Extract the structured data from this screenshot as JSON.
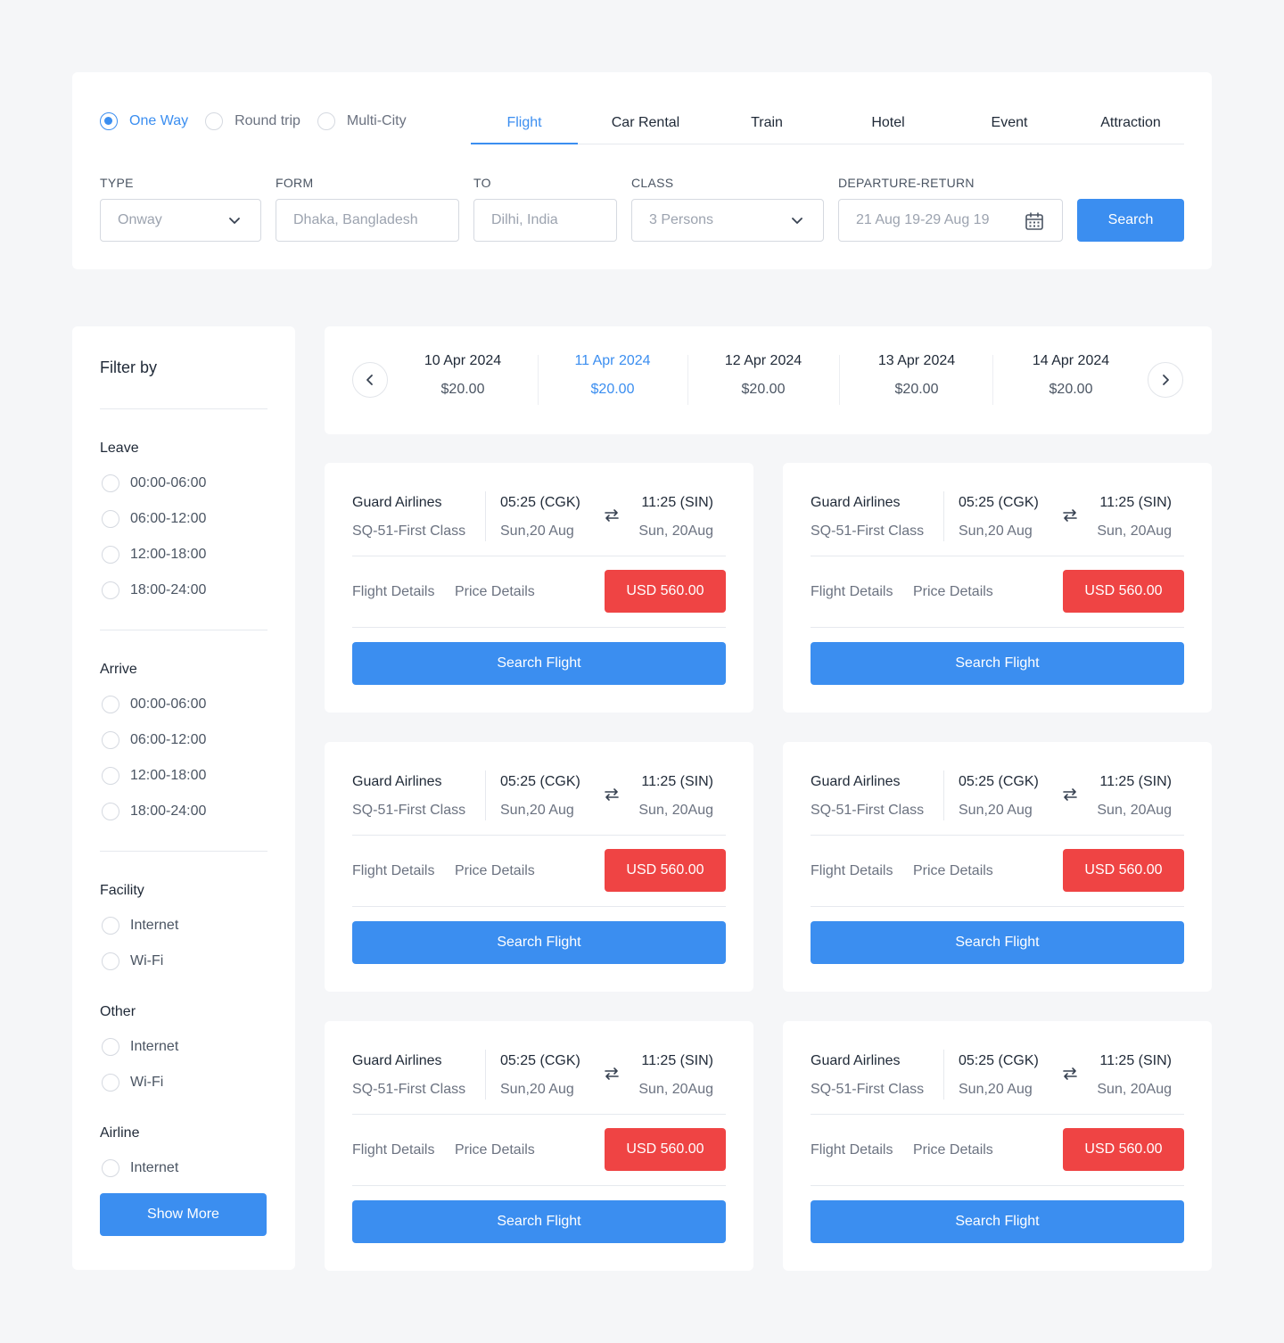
{
  "trip_types": [
    {
      "label": "One Way",
      "selected": true
    },
    {
      "label": "Round trip",
      "selected": false
    },
    {
      "label": "Multi-City",
      "selected": false
    }
  ],
  "tabs": [
    {
      "label": "Flight",
      "active": true
    },
    {
      "label": "Car Rental",
      "active": false
    },
    {
      "label": "Train",
      "active": false
    },
    {
      "label": "Hotel",
      "active": false
    },
    {
      "label": "Event",
      "active": false
    },
    {
      "label": "Attraction",
      "active": false
    }
  ],
  "search_form": {
    "type": {
      "label": "TYPE",
      "value": "Onway"
    },
    "from": {
      "label": "FORM",
      "placeholder": "Dhaka, Bangladesh"
    },
    "to": {
      "label": "TO",
      "placeholder": "Dilhi, India"
    },
    "class": {
      "label": "CLASS",
      "value": "3 Persons"
    },
    "dates": {
      "label": "DEPARTURE-RETURN",
      "placeholder": "21 Aug 19-29 Aug 19"
    },
    "search_label": "Search"
  },
  "filter": {
    "title": "Filter by",
    "leave": {
      "heading": "Leave",
      "options": [
        "00:00-06:00",
        "06:00-12:00",
        "12:00-18:00",
        "18:00-24:00"
      ]
    },
    "arrive": {
      "heading": "Arrive",
      "options": [
        "00:00-06:00",
        "06:00-12:00",
        "12:00-18:00",
        "18:00-24:00"
      ]
    },
    "facility": {
      "heading": "Facility",
      "options": [
        "Internet",
        "Wi-Fi"
      ]
    },
    "other": {
      "heading": "Other",
      "options": [
        "Internet",
        "Wi-Fi"
      ]
    },
    "airline": {
      "heading": "Airline",
      "options": [
        "Internet"
      ]
    },
    "show_more_label": "Show More"
  },
  "dates": [
    {
      "date": "10 Apr 2024",
      "price": "$20.00",
      "selected": false
    },
    {
      "date": "11 Apr 2024",
      "price": "$20.00",
      "selected": true
    },
    {
      "date": "12 Apr 2024",
      "price": "$20.00",
      "selected": false
    },
    {
      "date": "13 Apr 2024",
      "price": "$20.00",
      "selected": false
    },
    {
      "date": "14 Apr 2024",
      "price": "$20.00",
      "selected": false
    }
  ],
  "flights": [
    {
      "airline": "Guard Airlines",
      "class": "SQ-51-First Class",
      "depart_time": "05:25 (CGK)",
      "depart_date": "Sun,20 Aug",
      "arrive_time": "11:25 (SIN)",
      "arrive_date": "Sun, 20Aug",
      "flight_details": "Flight Details",
      "price_details": "Price Details",
      "price": "USD 560.00",
      "action": "Search Flight"
    },
    {
      "airline": "Guard Airlines",
      "class": "SQ-51-First Class",
      "depart_time": "05:25 (CGK)",
      "depart_date": "Sun,20 Aug",
      "arrive_time": "11:25 (SIN)",
      "arrive_date": "Sun, 20Aug",
      "flight_details": "Flight Details",
      "price_details": "Price Details",
      "price": "USD 560.00",
      "action": "Search Flight"
    },
    {
      "airline": "Guard Airlines",
      "class": "SQ-51-First Class",
      "depart_time": "05:25 (CGK)",
      "depart_date": "Sun,20 Aug",
      "arrive_time": "11:25 (SIN)",
      "arrive_date": "Sun, 20Aug",
      "flight_details": "Flight Details",
      "price_details": "Price Details",
      "price": "USD 560.00",
      "action": "Search Flight"
    },
    {
      "airline": "Guard Airlines",
      "class": "SQ-51-First Class",
      "depart_time": "05:25 (CGK)",
      "depart_date": "Sun,20 Aug",
      "arrive_time": "11:25 (SIN)",
      "arrive_date": "Sun, 20Aug",
      "flight_details": "Flight Details",
      "price_details": "Price Details",
      "price": "USD 560.00",
      "action": "Search Flight"
    },
    {
      "airline": "Guard Airlines",
      "class": "SQ-51-First Class",
      "depart_time": "05:25 (CGK)",
      "depart_date": "Sun,20 Aug",
      "arrive_time": "11:25 (SIN)",
      "arrive_date": "Sun, 20Aug",
      "flight_details": "Flight Details",
      "price_details": "Price Details",
      "price": "USD 560.00",
      "action": "Search Flight"
    },
    {
      "airline": "Guard Airlines",
      "class": "SQ-51-First Class",
      "depart_time": "05:25 (CGK)",
      "depart_date": "Sun,20 Aug",
      "arrive_time": "11:25 (SIN)",
      "arrive_date": "Sun, 20Aug",
      "flight_details": "Flight Details",
      "price_details": "Price Details",
      "price": "USD 560.00",
      "action": "Search Flight"
    }
  ],
  "icons": {
    "type_dropdown": "chevron-down-icon",
    "class_dropdown": "chevron-down-icon",
    "date_picker": "calendar-icon",
    "prev": "chevron-left-icon",
    "next": "chevron-right-icon",
    "swap": "swap-arrows-icon"
  },
  "colors": {
    "accent": "#3b8ef0",
    "price": "#ef4444",
    "background": "#f5f6f8"
  }
}
